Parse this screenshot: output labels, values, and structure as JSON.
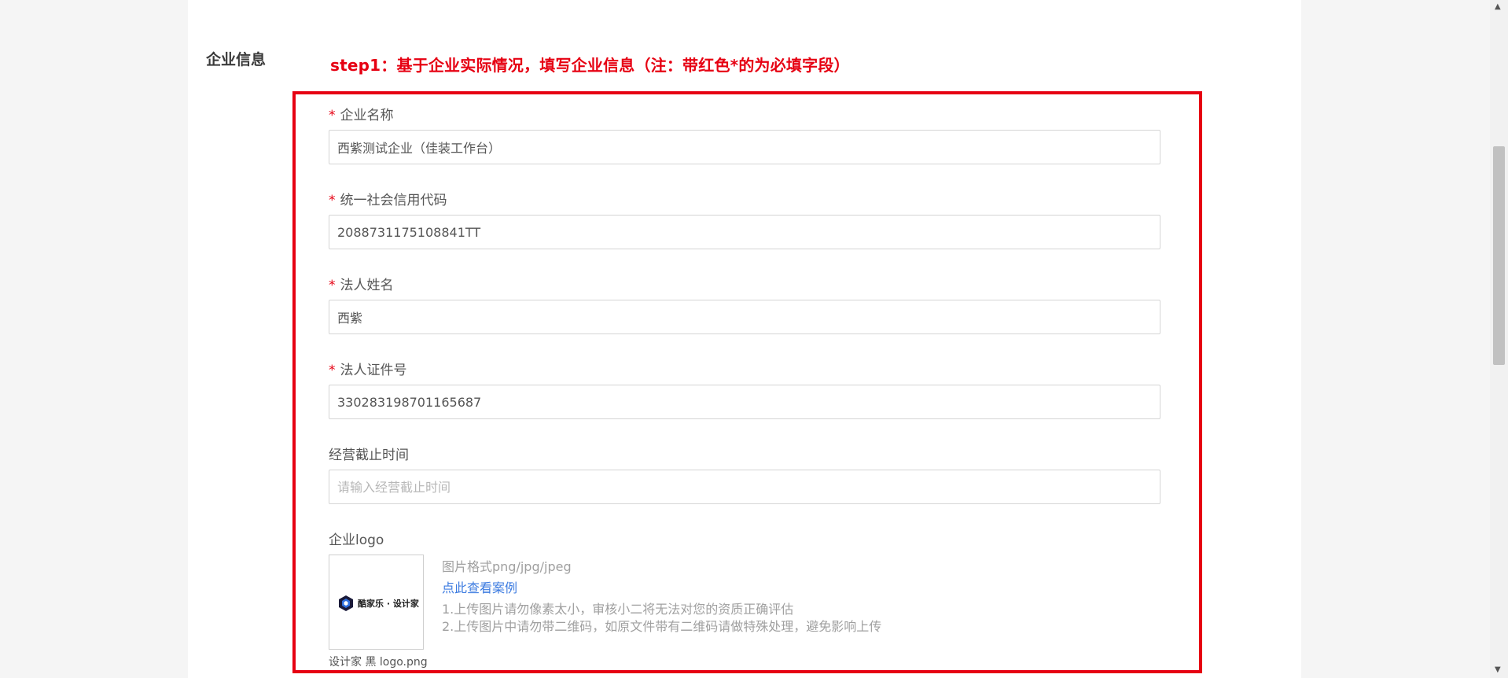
{
  "section": {
    "title": "企业信息"
  },
  "step": {
    "text": "step1：基于企业实际情况，填写企业信息（注：带红色*的为必填字段）"
  },
  "required_mark": "*",
  "fields": [
    {
      "label": "企业名称",
      "value": "西紫测试企业（佳装工作台）",
      "placeholder": ""
    },
    {
      "label": "统一社会信用代码",
      "value": "2088731175108841TT",
      "placeholder": ""
    },
    {
      "label": "法人姓名",
      "value": "西紫",
      "placeholder": ""
    },
    {
      "label": "法人证件号",
      "value": "330283198701165687",
      "placeholder": ""
    },
    {
      "label": "经营截止时间",
      "value": "",
      "placeholder": "请输入经营截止时间"
    }
  ],
  "logo": {
    "label": "企业logo",
    "file_name": "设计家 黑 logo.png",
    "image_text": "酷家乐 · 设计家",
    "format_hint": "图片格式png/jpg/jpeg",
    "example_link": "点此查看案例",
    "notes": [
      "1.上传图片请勿像素太小，审核小二将无法对您的资质正确评估",
      "2.上传图片中请勿带二维码，如原文件带有二维码请做特殊处理，避免影响上传"
    ]
  },
  "scrollbar": {
    "up_arrow": "▲",
    "down_arrow": "▼"
  },
  "colors": {
    "required": "#e60012",
    "link": "#3c7be0",
    "frame": "#e60012"
  }
}
